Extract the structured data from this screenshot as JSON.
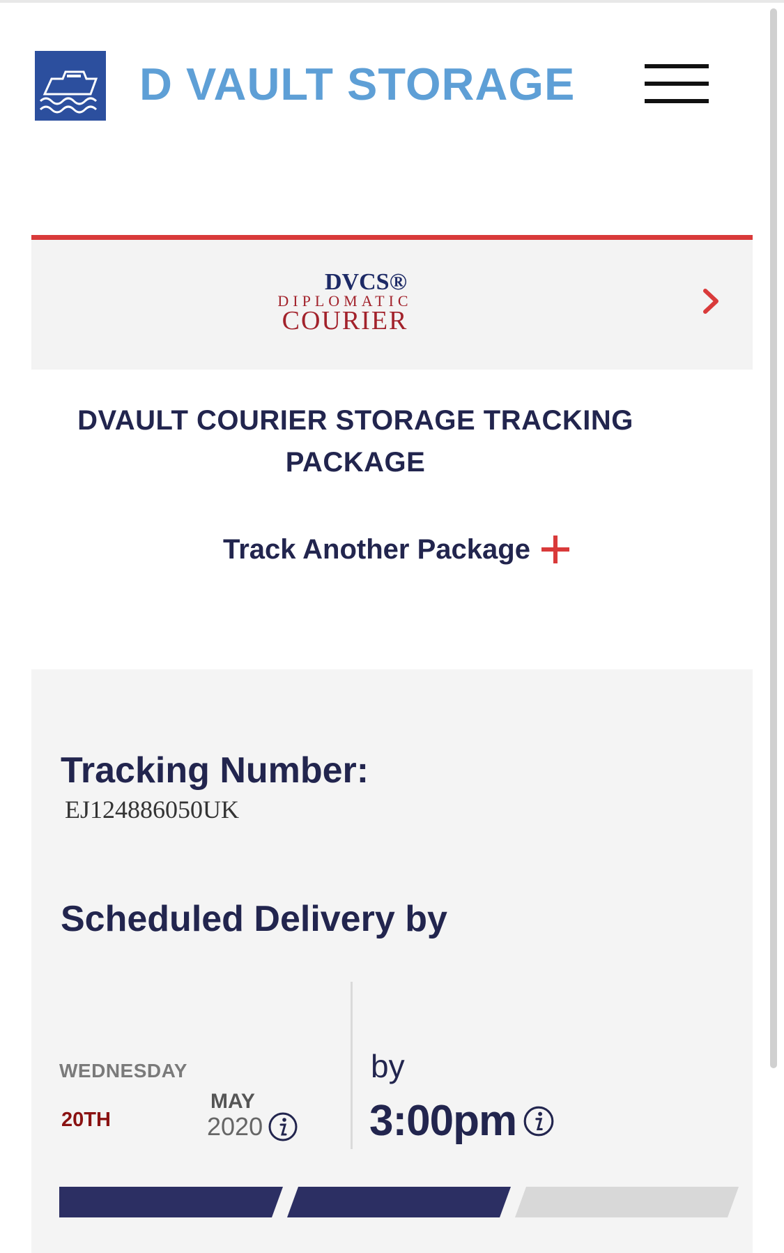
{
  "header": {
    "brand": "D VAULT STORAGE",
    "logo_icon": "ship-icon",
    "menu_icon": "hamburger-menu-icon"
  },
  "courier_logo": {
    "top": "DVCS®",
    "middle": "DIPLOMATIC",
    "bottom": "COURIER"
  },
  "title": "DVAULT COURIER STORAGE TRACKING PACKAGE",
  "track_another": {
    "label": "Track Another Package",
    "icon": "plus-icon"
  },
  "tracking": {
    "number_label": "Tracking Number:",
    "number_value": "EJ124886050UK",
    "scheduled_label": "Scheduled Delivery by",
    "weekday": "WEDNESDAY",
    "day": "20TH",
    "month": "MAY",
    "year": "2020",
    "by_label": "by",
    "time": "3:00pm",
    "progress": {
      "segments_total": 3,
      "segments_completed": 2
    }
  },
  "colors": {
    "brand_blue": "#5e9fd6",
    "logo_blue": "#2c4f9e",
    "navy": "#22254e",
    "accent_red": "#d93a3a",
    "courier_red": "#a2222b",
    "progress_done": "#2c2f63",
    "progress_todo": "#d8d8d8"
  }
}
